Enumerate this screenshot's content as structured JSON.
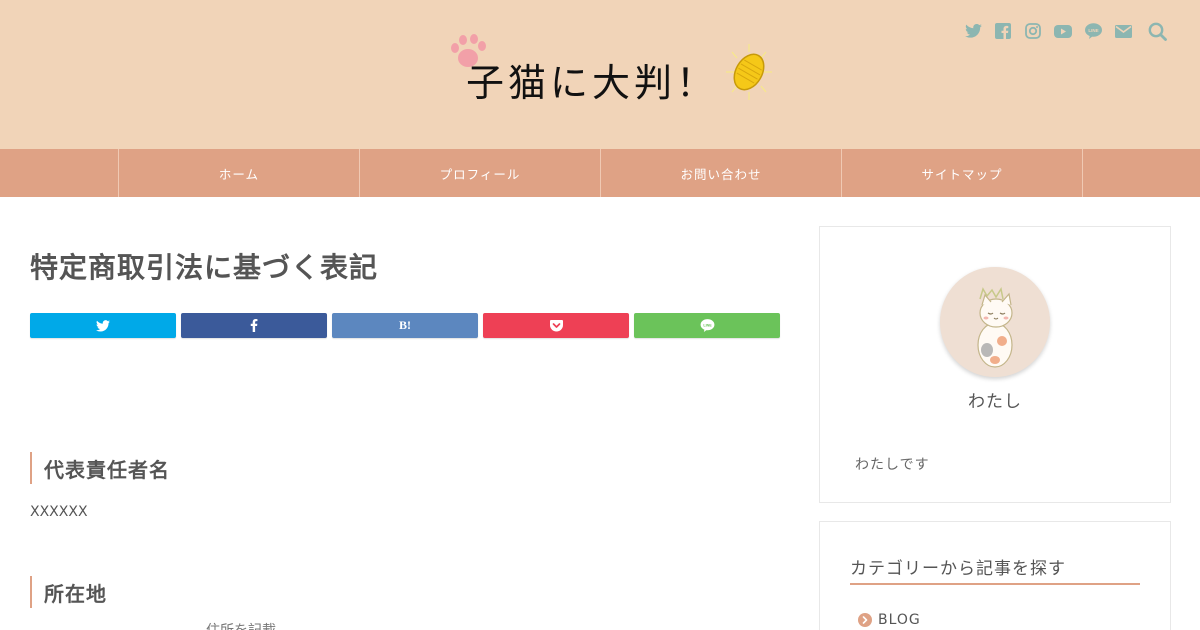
{
  "colors": {
    "header_bg": "#f1d4b8",
    "nav_bg": "#dfa285",
    "accent": "#dfa285",
    "social_icon": "#8cb6b1",
    "twitter": "#00a9e8",
    "facebook": "#3b5a9a",
    "hatena": "#5c87bf",
    "pocket": "#ee4055",
    "line": "#6bc35a"
  },
  "header": {
    "logo_text": "子猫に大判！",
    "social_icons": [
      "twitter-icon",
      "facebook-icon",
      "instagram-icon",
      "youtube-icon",
      "line-icon",
      "mail-icon"
    ],
    "search_icon": "search-icon"
  },
  "nav": {
    "items": [
      {
        "label": "ホーム"
      },
      {
        "label": "プロフィール"
      },
      {
        "label": "お問い合わせ"
      },
      {
        "label": "サイトマップ"
      }
    ]
  },
  "main": {
    "title": "特定商取引法に基づく表記",
    "share_buttons": [
      {
        "service": "twitter",
        "icon": "twitter-icon"
      },
      {
        "service": "facebook",
        "icon": "facebook-icon"
      },
      {
        "service": "hatena",
        "label": "B!"
      },
      {
        "service": "pocket",
        "icon": "pocket-icon"
      },
      {
        "service": "line",
        "icon": "line-icon"
      }
    ],
    "sections": [
      {
        "heading": "代表責任者名",
        "body": "XXXXXX"
      },
      {
        "heading": "所在地",
        "body": ""
      }
    ],
    "cutoff_text": "住所を記載"
  },
  "sidebar": {
    "profile": {
      "name": "わたし",
      "description": "わたしです"
    },
    "category": {
      "title": "カテゴリーから記事を探す",
      "items": [
        {
          "label": "BLOG"
        }
      ]
    }
  }
}
